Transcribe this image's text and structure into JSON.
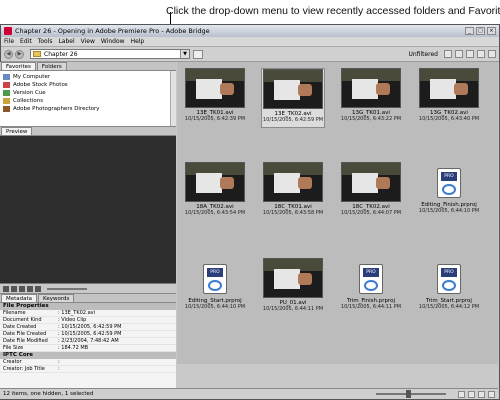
{
  "callout": "Click the drop-down menu to view recently accessed folders and Favorites.",
  "window": {
    "title": "Chapter 26 - Opening in Adobe Premiere Pro - Adobe Bridge",
    "menus": [
      "File",
      "Edit",
      "Tools",
      "Label",
      "View",
      "Window",
      "Help"
    ]
  },
  "toolbar": {
    "path": "Chapter 26",
    "filter": "Unfiltered"
  },
  "panels": {
    "tabs": [
      "Favorites",
      "Folders"
    ],
    "favorites": [
      "My Computer",
      "Adobe Stock Photos",
      "Version Cue",
      "Collections",
      "Adobe Photographers Directory"
    ],
    "preview_tab": "Preview",
    "meta_tabs": [
      "Metadata",
      "Keywords"
    ]
  },
  "metadata": {
    "section1": "File Properties",
    "rows": [
      {
        "k": "Filename",
        "v": ": 13E_TK02.avi"
      },
      {
        "k": "Document Kind",
        "v": ": Video Clip"
      },
      {
        "k": "Date Created",
        "v": ": 10/15/2005, 6:42:59 PM"
      },
      {
        "k": "Date File Created",
        "v": ": 10/15/2005, 6:42:59 PM"
      },
      {
        "k": "Date File Modified",
        "v": ": 2/23/2004, 7:48:42 AM"
      },
      {
        "k": "File Size",
        "v": ": 184.72 MB"
      }
    ],
    "section2": "IPTC Core",
    "rows2": [
      {
        "k": "Creator",
        "v": ":"
      },
      {
        "k": "Creator: Job Title",
        "v": ":"
      }
    ]
  },
  "thumbs": [
    {
      "name": "13E_TK01.avi",
      "date": "10/15/2005, 6:42:39 PM",
      "kind": "video"
    },
    {
      "name": "13E_TK02.avi",
      "date": "10/15/2005, 6:42:59 PM",
      "kind": "video"
    },
    {
      "name": "13G_TK01.avi",
      "date": "10/15/2005, 6:43:22 PM",
      "kind": "video"
    },
    {
      "name": "13G_TK02.avi",
      "date": "10/15/2005, 6:43:40 PM",
      "kind": "video"
    },
    {
      "name": "18A_TK02.avi",
      "date": "10/15/2005, 6:43:54 PM",
      "kind": "video"
    },
    {
      "name": "18C_TK01.avi",
      "date": "10/15/2005, 6:43:58 PM",
      "kind": "video"
    },
    {
      "name": "18C_TK02.avi",
      "date": "10/15/2005, 6:44:07 PM",
      "kind": "video"
    },
    {
      "name": "Editing_Finish.prproj",
      "date": "10/15/2005, 6:44:10 PM",
      "kind": "project"
    },
    {
      "name": "Editing_Start.prproj",
      "date": "10/15/2005, 6:44:10 PM",
      "kind": "project"
    },
    {
      "name": "PU_01.avi",
      "date": "10/15/2005, 6:44:11 PM",
      "kind": "video"
    },
    {
      "name": "Trim_Finish.prproj",
      "date": "10/15/2005, 6:44:11 PM",
      "kind": "project"
    },
    {
      "name": "Trim_Start.prproj",
      "date": "10/15/2005, 6:44:12 PM",
      "kind": "project"
    }
  ],
  "status": "12 items, one hidden, 1 selected"
}
